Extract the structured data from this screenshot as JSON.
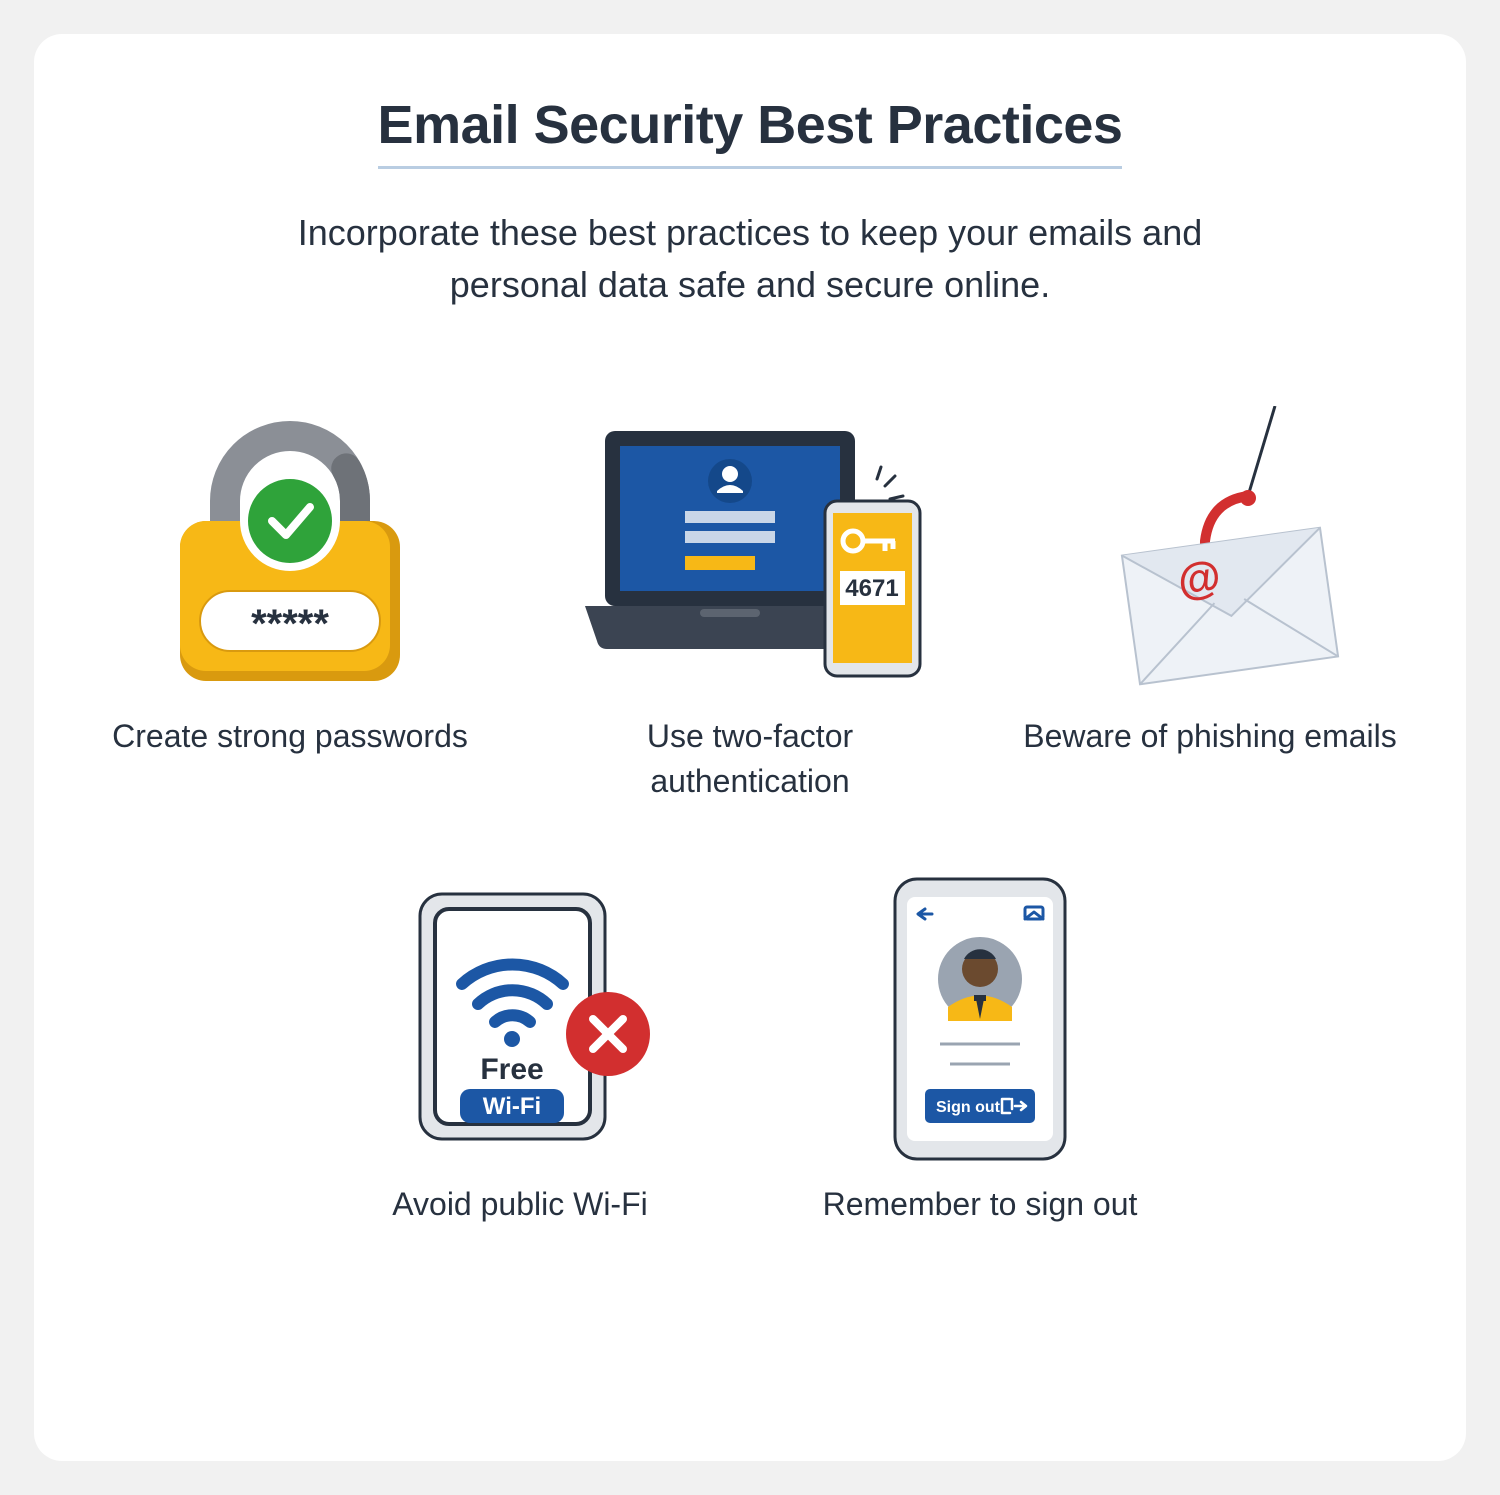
{
  "title": "Email Security Best Practices",
  "subtitle": "Incorporate these best practices to keep your emails and personal data safe and secure online.",
  "items": [
    {
      "caption": "Create strong passwords"
    },
    {
      "caption": "Use two-factor authentication"
    },
    {
      "caption": "Beware of phishing emails"
    },
    {
      "caption": "Avoid public Wi-Fi"
    },
    {
      "caption": "Remember to sign out"
    }
  ],
  "labels": {
    "password_mask": "*****",
    "two_factor_code": "4671",
    "wifi_free": "Free",
    "wifi_label": "Wi-Fi",
    "sign_out": "Sign out",
    "at_symbol": "@"
  },
  "colors": {
    "blue": "#1c57a5",
    "dark_blue": "#14488a",
    "yellow": "#f7b816",
    "dark_yellow": "#d99a0f",
    "green": "#2fa33a",
    "grey": "#8b8f96",
    "red": "#d22f2f",
    "text": "#27313f",
    "lightgrey": "#d7dbe0",
    "envelope": "#eef2f7"
  }
}
